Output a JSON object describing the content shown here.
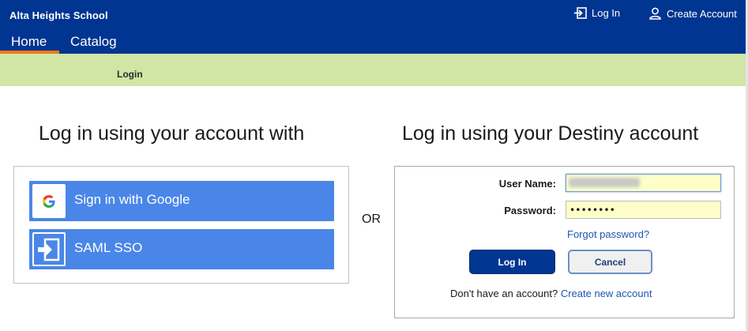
{
  "header": {
    "school_name": "Alta Heights School",
    "login_link": "Log In",
    "create_account_link": "Create Account",
    "tabs": [
      {
        "label": "Home",
        "active": true
      },
      {
        "label": "Catalog",
        "active": false
      }
    ]
  },
  "breadcrumb": {
    "current": "Login"
  },
  "external_login": {
    "heading": "Log in using your account with",
    "buttons": [
      {
        "label": "Sign in with Google",
        "icon": "google-icon"
      },
      {
        "label": "SAML SSO",
        "icon": "login-arrow-icon"
      }
    ]
  },
  "separator_text": "OR",
  "destiny_login": {
    "heading": "Log in using your Destiny account",
    "username_label": "User Name:",
    "username_value": "",
    "password_label": "Password:",
    "password_value": "••••••••",
    "forgot_password": "Forgot password?",
    "login_button": "Log In",
    "cancel_button": "Cancel",
    "no_account_text": "Don't have an account?",
    "create_account_link": "Create new account"
  },
  "colors": {
    "header_bg": "#003591",
    "active_tab_underline": "#f07c1b",
    "breadcrumb_bg": "#d1e5a5",
    "sso_button_bg": "#4a86e8",
    "input_autofill_bg": "#fefec8",
    "link": "#1b56b0"
  }
}
